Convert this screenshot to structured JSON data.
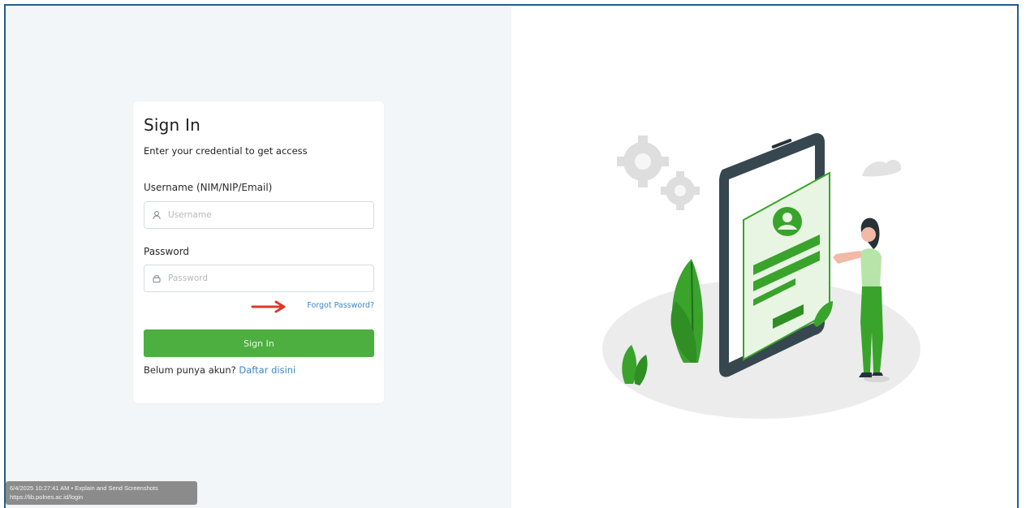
{
  "login": {
    "title": "Sign In",
    "subtitle": "Enter your credential to get access",
    "username": {
      "label": "Username (NIM/NIP/Email)",
      "placeholder": "Username",
      "value": "",
      "icon": "user-icon"
    },
    "password": {
      "label": "Password",
      "placeholder": "Password",
      "value": "",
      "icon": "lock-icon"
    },
    "forgot_password_label": "Forgot Password?",
    "submit_label": "Sign In",
    "register_prompt": "Belum punya akun?",
    "register_link": "Daftar disini"
  },
  "overlay": {
    "line1": "6/4/2025 10:27:41 AM • Explain and Send Screenshots",
    "line2": "https://lib.polnes.ac.id/login"
  },
  "colors": {
    "accent_green": "#4caf3f",
    "link_blue": "#3f86c6",
    "annotation_arrow": "#d93a2b",
    "frame_border": "#1f5f8b"
  }
}
